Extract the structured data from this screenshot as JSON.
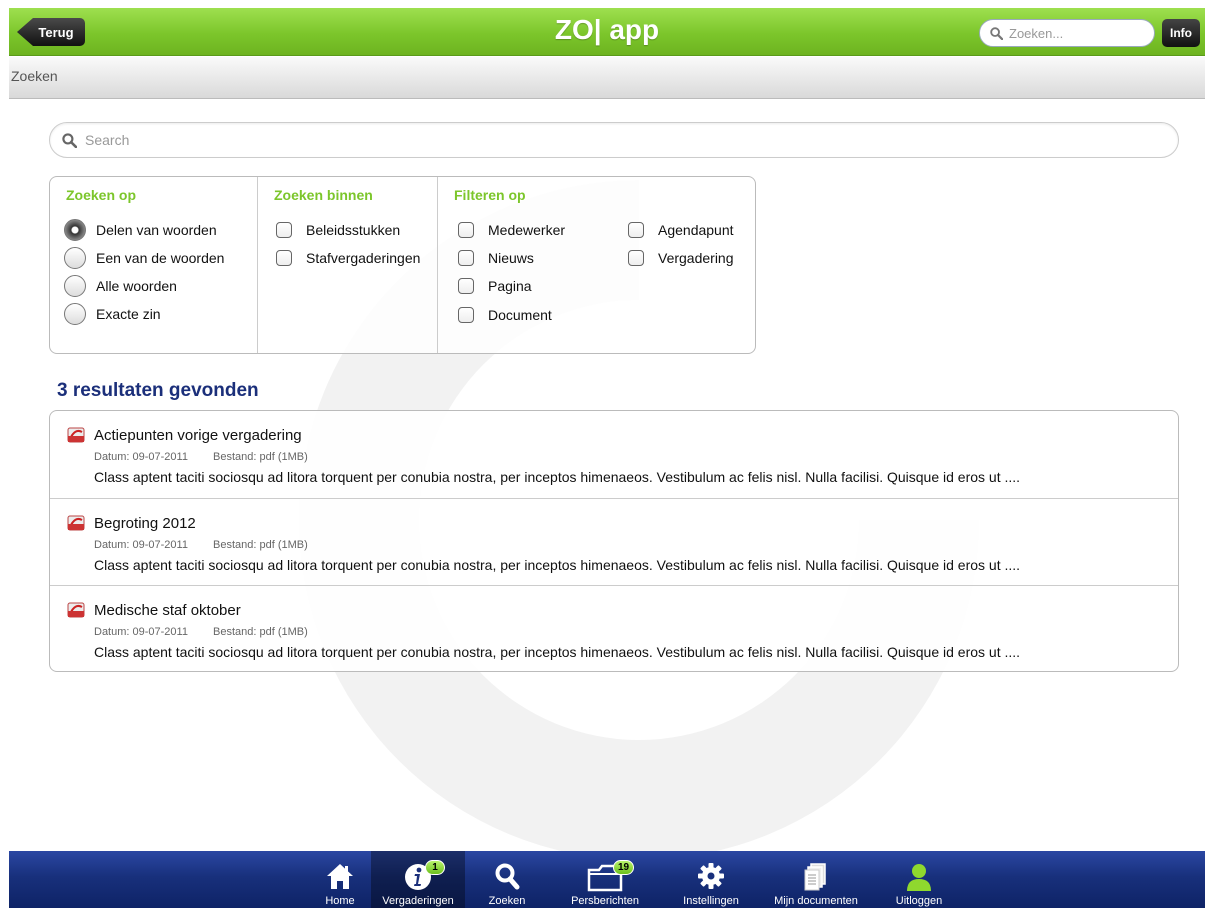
{
  "header": {
    "back_label": "Terug",
    "title": "ZO| app",
    "search_placeholder": "Zoeken...",
    "info_label": "Info"
  },
  "subheader": {
    "title": "Zoeken"
  },
  "search": {
    "placeholder": "Search"
  },
  "options": {
    "zoeken_op": {
      "title": "Zoeken op",
      "items": [
        "Delen van woorden",
        "Een van de woorden",
        "Alle woorden",
        "Exacte zin"
      ],
      "selected": "Delen van woorden"
    },
    "zoeken_binnen": {
      "title": "Zoeken binnen",
      "items": [
        "Beleidsstukken",
        "Stafvergaderingen"
      ]
    },
    "filteren_op": {
      "title": "Filteren op",
      "items": [
        "Medewerker",
        "Nieuws",
        "Pagina",
        "Document",
        "Agendapunt",
        "Vergadering"
      ]
    }
  },
  "results": {
    "title": "3 resultaten gevonden",
    "items": [
      {
        "title": "Actiepunten vorige vergadering",
        "date": "Datum: 09-07-2011",
        "file": "Bestand: pdf (1MB)",
        "description": "Class aptent taciti sociosqu ad litora torquent per conubia nostra, per inceptos himenaeos. Vestibulum ac felis nisl. Nulla facilisi. Quisque id eros ut ...."
      },
      {
        "title": "Begroting 2012",
        "date": "Datum: 09-07-2011",
        "file": "Bestand: pdf (1MB)",
        "description": "Class aptent taciti sociosqu ad litora torquent per conubia nostra, per inceptos himenaeos. Vestibulum ac felis nisl. Nulla facilisi. Quisque id eros ut ...."
      },
      {
        "title": "Medische staf oktober",
        "date": "Datum: 09-07-2011",
        "file": "Bestand: pdf (1MB)",
        "description": "Class aptent taciti sociosqu ad litora torquent per conubia nostra, per inceptos himenaeos. Vestibulum ac felis nisl. Nulla facilisi. Quisque id eros ut ...."
      }
    ]
  },
  "tabbar": {
    "active": "Vergaderingen",
    "tabs": [
      {
        "label": "Home",
        "icon": "home-icon"
      },
      {
        "label": "Vergaderingen",
        "icon": "info-icon",
        "badge": "1"
      },
      {
        "label": "Zoeken",
        "icon": "search-icon"
      },
      {
        "label": "Persberichten",
        "icon": "folder-icon",
        "badge": "19"
      },
      {
        "label": "Instellingen",
        "icon": "gear-icon"
      },
      {
        "label": "Mijn documenten",
        "icon": "documents-icon"
      },
      {
        "label": "Uitloggen",
        "icon": "user-icon"
      }
    ]
  },
  "colors": {
    "accent_green": "#7cc62b",
    "navy": "#1b2f7a",
    "tabbar_blue": "#18307c"
  }
}
